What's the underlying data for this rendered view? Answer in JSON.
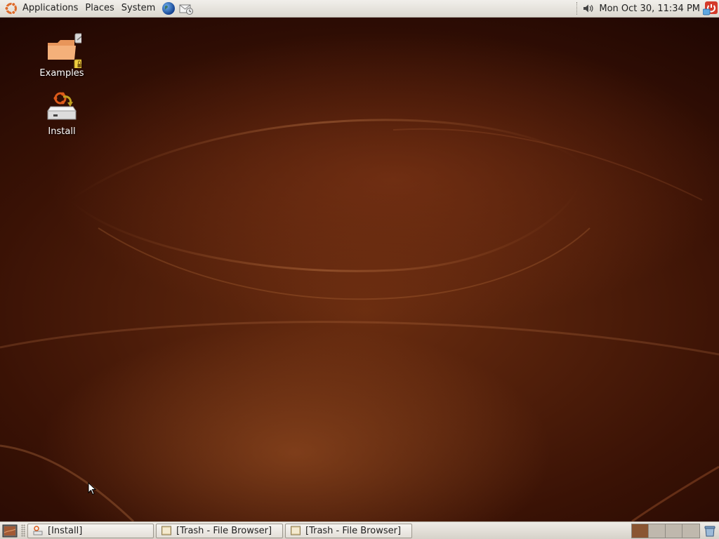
{
  "top_panel": {
    "menus": [
      {
        "label": "Applications"
      },
      {
        "label": "Places"
      },
      {
        "label": "System"
      }
    ],
    "launchers": [
      {
        "icon": "web-browser-globe-icon"
      },
      {
        "icon": "email-client-icon"
      }
    ],
    "volume_icon": "speaker-icon",
    "clock": "Mon Oct 30, 11:34 PM",
    "power_icon": "logout-power-icon"
  },
  "desktop": {
    "icons": [
      {
        "label": "Examples",
        "icon": "folder-icon"
      },
      {
        "label": "Install",
        "icon": "install-drive-icon"
      }
    ]
  },
  "bottom_panel": {
    "show_desktop_icon": "show-desktop-icon",
    "tasks": [
      {
        "label": "[Install]",
        "icon": "install-window-icon"
      },
      {
        "label": "[Trash - File Browser]",
        "icon": "file-browser-icon"
      },
      {
        "label": "[Trash - File Browser]",
        "icon": "file-browser-icon"
      }
    ],
    "workspaces": [
      {
        "name": "workspace-1",
        "active": true
      },
      {
        "name": "workspace-2",
        "active": false
      },
      {
        "name": "workspace-3",
        "active": false
      },
      {
        "name": "workspace-4",
        "active": false
      }
    ],
    "trash_icon": "trash-icon"
  },
  "colors": {
    "panel_bg": "#e6e2db",
    "wallpaper_dark": "#2a0c04",
    "wallpaper_light": "#8a4a22",
    "workspace_active": "#8a5532"
  }
}
